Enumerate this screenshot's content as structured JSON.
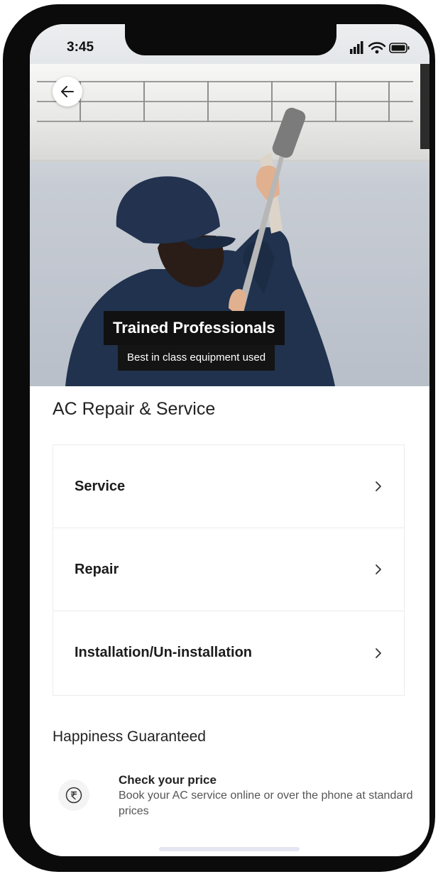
{
  "status_bar": {
    "time": "3:45"
  },
  "hero": {
    "banner_title": "Trained Professionals",
    "banner_subtitle": "Best in class equipment used"
  },
  "page": {
    "title": "AC Repair & Service"
  },
  "menu": {
    "items": [
      {
        "label": "Service"
      },
      {
        "label": "Repair"
      },
      {
        "label": "Installation/Un-installation"
      }
    ]
  },
  "happiness": {
    "title": "Happiness Guaranteed",
    "feature": {
      "icon": "rupee-icon",
      "title": "Check your price",
      "description": "Book your AC service online or over the phone at standard prices"
    }
  },
  "icons": {
    "back": "arrow-left-icon",
    "chevron": "chevron-right-icon"
  }
}
